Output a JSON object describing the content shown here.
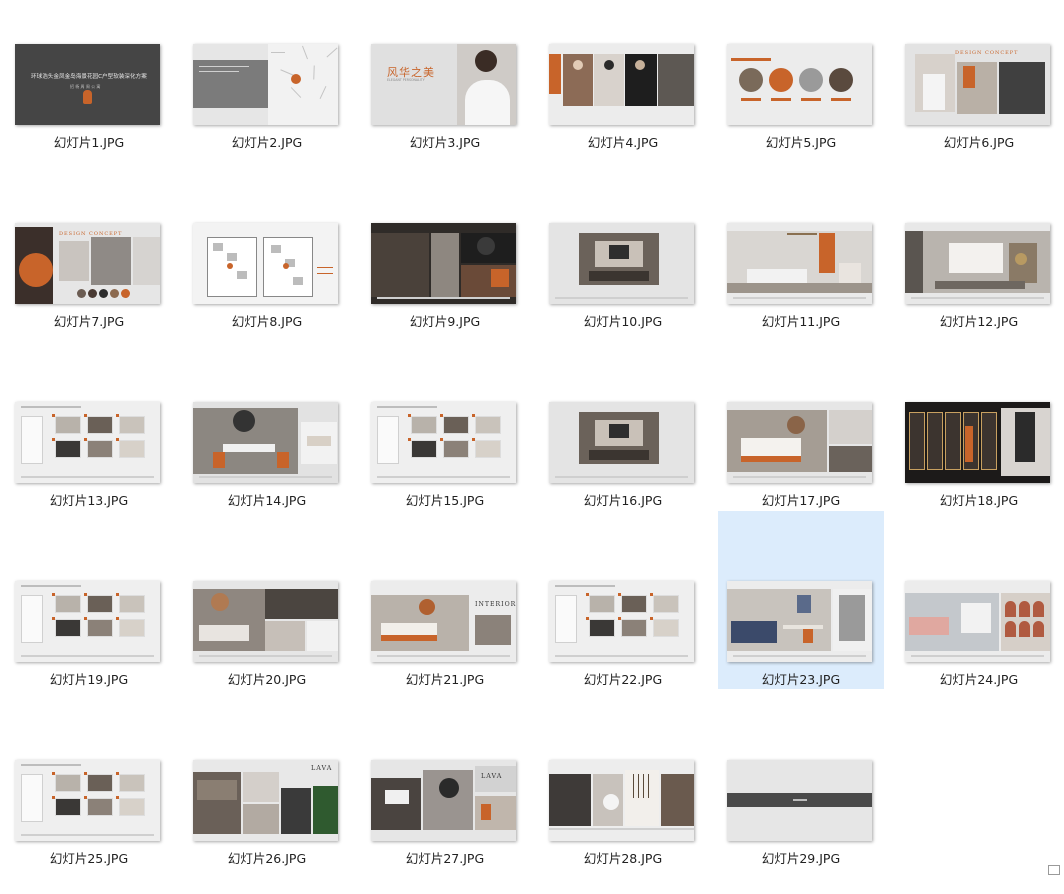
{
  "window": {
    "selected_index": 22
  },
  "files": [
    {
      "name": "幻灯片1.JPG",
      "kind": "cover",
      "text": "环球浩头金凤金岛海景花园C户型软装深化方案",
      "sub": "招 杨 周 周 公 寓"
    },
    {
      "name": "幻灯片2.JPG",
      "kind": "map"
    },
    {
      "name": "幻灯片3.JPG",
      "kind": "title-portrait",
      "text": "风华之美",
      "sub": "ELEGANT PERSONALITY"
    },
    {
      "name": "幻灯片4.JPG",
      "kind": "people"
    },
    {
      "name": "幻灯片5.JPG",
      "kind": "circles"
    },
    {
      "name": "幻灯片6.JPG",
      "kind": "concept-a",
      "text": "DESIGN CONCEPT"
    },
    {
      "name": "幻灯片7.JPG",
      "kind": "concept-b",
      "text": "DESIGN CONCEPT"
    },
    {
      "name": "幻灯片8.JPG",
      "kind": "floorplan"
    },
    {
      "name": "幻灯片9.JPG",
      "kind": "dark-collage"
    },
    {
      "name": "幻灯片10.JPG",
      "kind": "room-render"
    },
    {
      "name": "幻灯片11.JPG",
      "kind": "living"
    },
    {
      "name": "幻灯片12.JPG",
      "kind": "living2"
    },
    {
      "name": "幻灯片13.JPG",
      "kind": "board"
    },
    {
      "name": "幻灯片14.JPG",
      "kind": "dining"
    },
    {
      "name": "幻灯片15.JPG",
      "kind": "board"
    },
    {
      "name": "幻灯片16.JPG",
      "kind": "room-render"
    },
    {
      "name": "幻灯片17.JPG",
      "kind": "bedroom"
    },
    {
      "name": "幻灯片18.JPG",
      "kind": "closet"
    },
    {
      "name": "幻灯片19.JPG",
      "kind": "board"
    },
    {
      "name": "幻灯片20.JPG",
      "kind": "bedroom2"
    },
    {
      "name": "幻灯片21.JPG",
      "kind": "interior",
      "text": "INTERIOR"
    },
    {
      "name": "幻灯片22.JPG",
      "kind": "board"
    },
    {
      "name": "幻灯片23.JPG",
      "kind": "study"
    },
    {
      "name": "幻灯片24.JPG",
      "kind": "kids"
    },
    {
      "name": "幻灯片25.JPG",
      "kind": "board"
    },
    {
      "name": "幻灯片26.JPG",
      "kind": "lava",
      "text": "LAVA"
    },
    {
      "name": "幻灯片27.JPG",
      "kind": "lava2",
      "text": "LAVA"
    },
    {
      "name": "幻灯片28.JPG",
      "kind": "bath"
    },
    {
      "name": "幻灯片29.JPG",
      "kind": "end"
    }
  ],
  "colors": {
    "selection": "#dcecfc",
    "accent": "#c8642a",
    "dark": "#3e3e3e"
  }
}
